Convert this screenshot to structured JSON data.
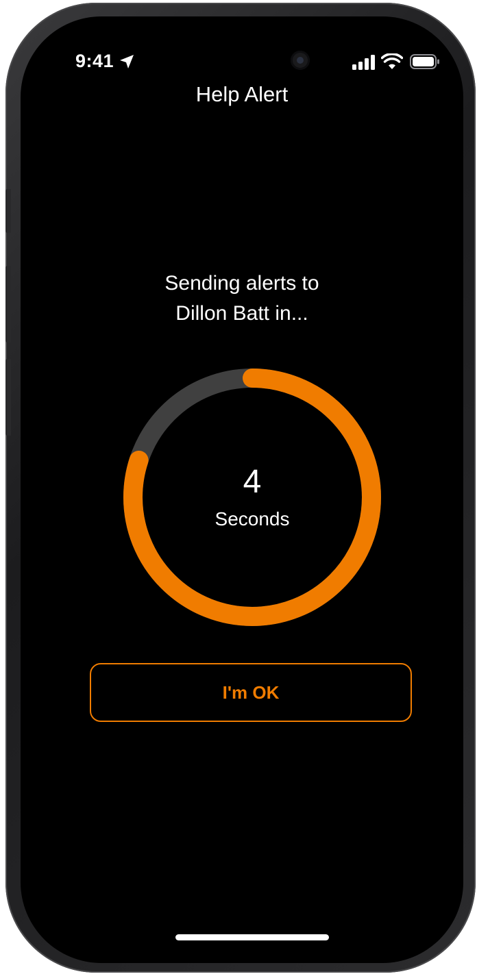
{
  "status_bar": {
    "time": "9:41",
    "icons": [
      "location-arrow-icon",
      "front-camera",
      "cellular-signal-icon",
      "wifi-icon",
      "battery-icon"
    ]
  },
  "nav": {
    "title": "Help Alert"
  },
  "alert": {
    "message_line1": "Sending alerts to",
    "message_line2": "Dillon Batt in..."
  },
  "countdown": {
    "value": "4",
    "unit": "Seconds",
    "progress_fraction": 0.8
  },
  "actions": {
    "ok_label": "I'm OK"
  },
  "colors": {
    "accent": "#f07c00",
    "track": "#404040",
    "background": "#000000",
    "text": "#ffffff"
  }
}
